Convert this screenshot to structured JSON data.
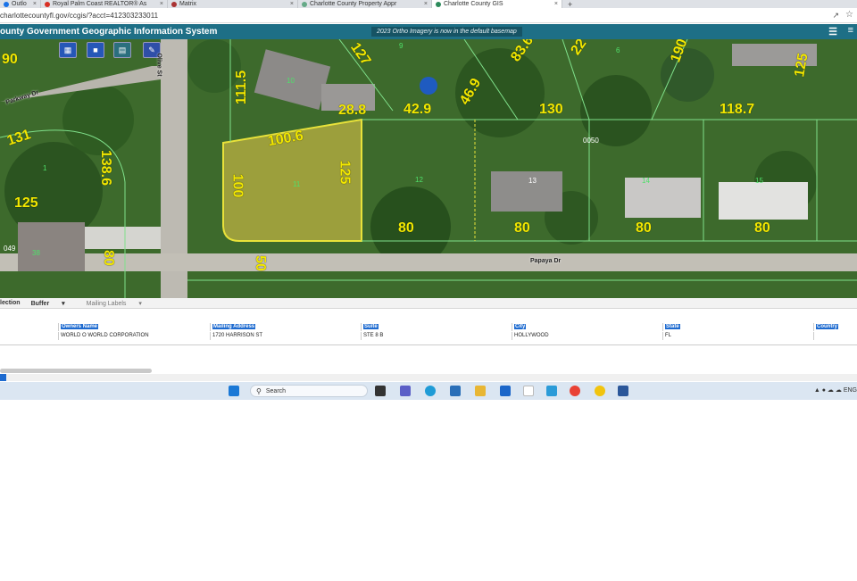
{
  "browser": {
    "tabs": [
      {
        "title": "Outlo",
        "color": "#1a73e8",
        "active": false
      },
      {
        "title": "Royal Palm Coast REALTOR® As",
        "color": "#d93025",
        "active": false
      },
      {
        "title": "Matrix",
        "color": "#a33",
        "active": false
      },
      {
        "title": "Charlotte County Property Appr",
        "color": "#6a8",
        "active": false
      },
      {
        "title": "Charlotte County GIS",
        "color": "#2c8a5b",
        "active": true
      }
    ],
    "new_tab_glyph": "+",
    "close_glyph": "×",
    "url": "charlottecountyfl.gov/ccgis/?acct=412303233011"
  },
  "gis": {
    "title": "ounty Government Geographic Information System",
    "notice": "2023 Ortho Imagery is now in the default basemap"
  },
  "map": {
    "dimensions": [
      "90",
      "131",
      "138.6",
      "125",
      "80",
      "111.5",
      "127",
      "28.8",
      "42.9",
      "46.9",
      "83.6",
      "22",
      "130",
      "190",
      "118.7",
      "125",
      "100.6",
      "100",
      "125",
      "80",
      "80",
      "80",
      "80",
      "50"
    ],
    "lots": [
      "1",
      "10",
      "11",
      "12",
      "13",
      "14",
      "15",
      "9",
      "6",
      "38",
      "0050",
      "049"
    ],
    "streets": [
      "Papaya Dr",
      "Parkway Dr",
      "Olive St"
    ]
  },
  "lowerbar": {
    "selection": "lection",
    "buffer": "Buffer",
    "mailing": "Mailing Labels"
  },
  "results": {
    "columns": [
      "Owners Name",
      "Mailing Address",
      "Suite",
      "City",
      "State",
      "Country"
    ],
    "row": [
      "WORLD O WORLD CORPORATION",
      "1720 HARRISON ST",
      "STE 8 B",
      "HOLLYWOOD",
      "FL",
      ""
    ]
  },
  "taskbar": {
    "search_placeholder": "Search",
    "lang": "ENG"
  },
  "colors": {
    "header": "#1e6f86",
    "accent": "#1e6bd0",
    "dimension": "#f3e800",
    "parcel_line": "#7fe08a"
  }
}
